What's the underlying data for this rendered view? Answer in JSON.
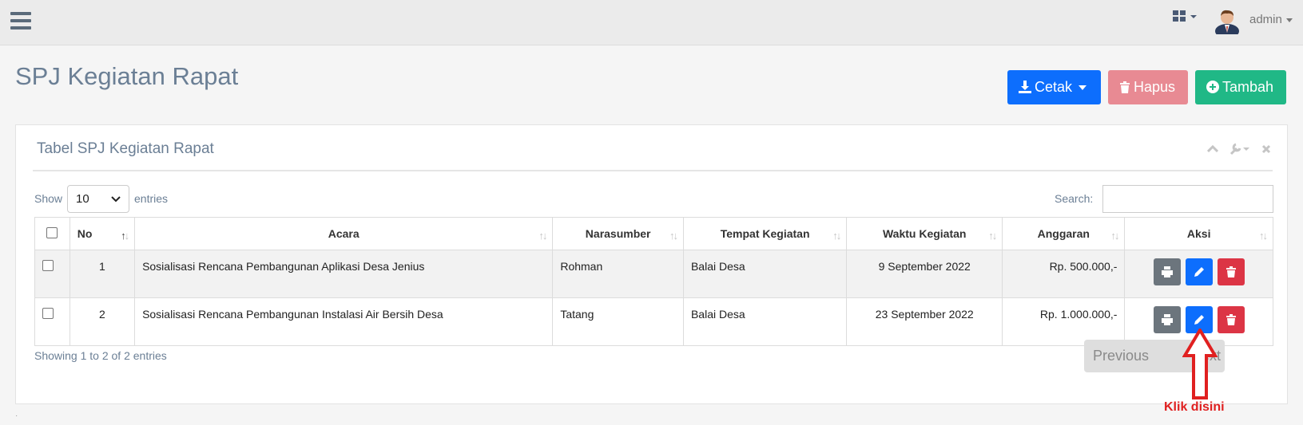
{
  "topbar": {
    "user_name": "admin"
  },
  "page": {
    "title": "SPJ Kegiatan Rapat"
  },
  "actions": {
    "cetak_label": "Cetak",
    "hapus_label": "Hapus",
    "tambah_label": "Tambah",
    "colors": {
      "cetak": "#0d6efd",
      "hapus": "#e88a93",
      "tambah": "#20b886"
    }
  },
  "panel": {
    "title": "Tabel SPJ Kegiatan Rapat"
  },
  "table_controls": {
    "show_label": "Show",
    "entries_value": "10",
    "entries_label": "entries",
    "search_label": "Search:",
    "search_value": ""
  },
  "table": {
    "columns": [
      "No",
      "Acara",
      "Narasumber",
      "Tempat Kegiatan",
      "Waktu Kegiatan",
      "Anggaran",
      "Aksi"
    ],
    "rows": [
      {
        "no": "1",
        "acara": "Sosialisasi Rencana Pembangunan Aplikasi Desa Jenius",
        "narasumber": "Rohman",
        "tempat": "Balai Desa",
        "waktu": "9 September 2022",
        "anggaran": "Rp. 500.000,-"
      },
      {
        "no": "2",
        "acara": "Sosialisasi Rencana Pembangunan Instalasi Air Bersih Desa",
        "narasumber": "Tatang",
        "tempat": "Balai Desa",
        "waktu": "23 September 2022",
        "anggaran": "Rp. 1.000.000,-"
      }
    ]
  },
  "footer": {
    "showing": "Showing 1 to 2 of 2 entries",
    "previous_label": "Previous",
    "next_label": "Next"
  },
  "annotation": {
    "text": "Klik disini",
    "color": "#e02020"
  }
}
